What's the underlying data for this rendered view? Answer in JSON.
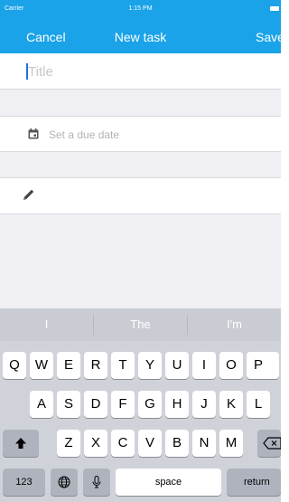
{
  "status_bar": {
    "carrier": "Carrier",
    "time": "1:15 PM"
  },
  "nav": {
    "cancel": "Cancel",
    "title": "New task",
    "save": "Save"
  },
  "form": {
    "title_placeholder": "Title",
    "due_date_label": "Set a due date"
  },
  "keyboard": {
    "predictions": [
      "I",
      "The",
      "I'm"
    ],
    "row1": [
      "Q",
      "W",
      "E",
      "R",
      "T",
      "Y",
      "U",
      "I",
      "O",
      "P"
    ],
    "row2": [
      "A",
      "S",
      "D",
      "F",
      "G",
      "H",
      "J",
      "K",
      "L"
    ],
    "row3": [
      "Z",
      "X",
      "C",
      "V",
      "B",
      "N",
      "M"
    ],
    "numbers_key": "123",
    "space_key": "space",
    "return_key": "return"
  },
  "colors": {
    "accent": "#1aa3e8",
    "keyboard_bg": "#cfd3d9"
  }
}
